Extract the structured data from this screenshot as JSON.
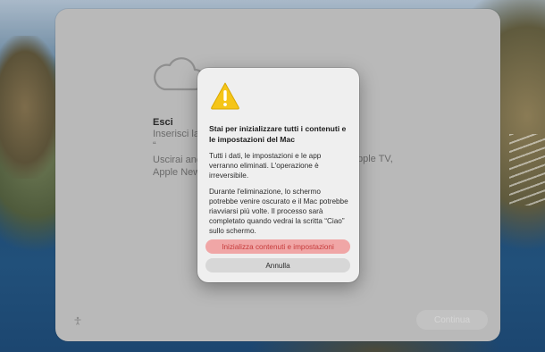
{
  "background_panel": {
    "title": "Esci",
    "text_line1": "Inserisci la",
    "quote_mark": "“",
    "text_line2a": "Uscirai anc",
    "text_line2b": "Apple New",
    "text_right": "pple TV,",
    "continue_label": "Continua"
  },
  "alert": {
    "heading": "Stai per inizializzare tutti i contenuti e le impostazioni del Mac",
    "paragraph1": "Tutti i dati, le impostazioni e le app verranno eliminati. L'operazione è irreversibile.",
    "paragraph2": "Durante l'eliminazione, lo schermo potrebbe venire oscurato e il Mac potrebbe riavviarsi più volte. Il processo sarà completato quando vedrai la scritta “Ciao” sullo schermo.",
    "confirm_label": "Inizializza contenuti e impostazioni",
    "cancel_label": "Annulla"
  },
  "icons": {
    "warning": "warning-icon",
    "cloud": "icloud-icon",
    "status": "accessibility-icon"
  },
  "colors": {
    "destructive_bg": "#f0a6a6",
    "destructive_text": "#c63a3a",
    "warning_yellow": "#f5c518"
  }
}
